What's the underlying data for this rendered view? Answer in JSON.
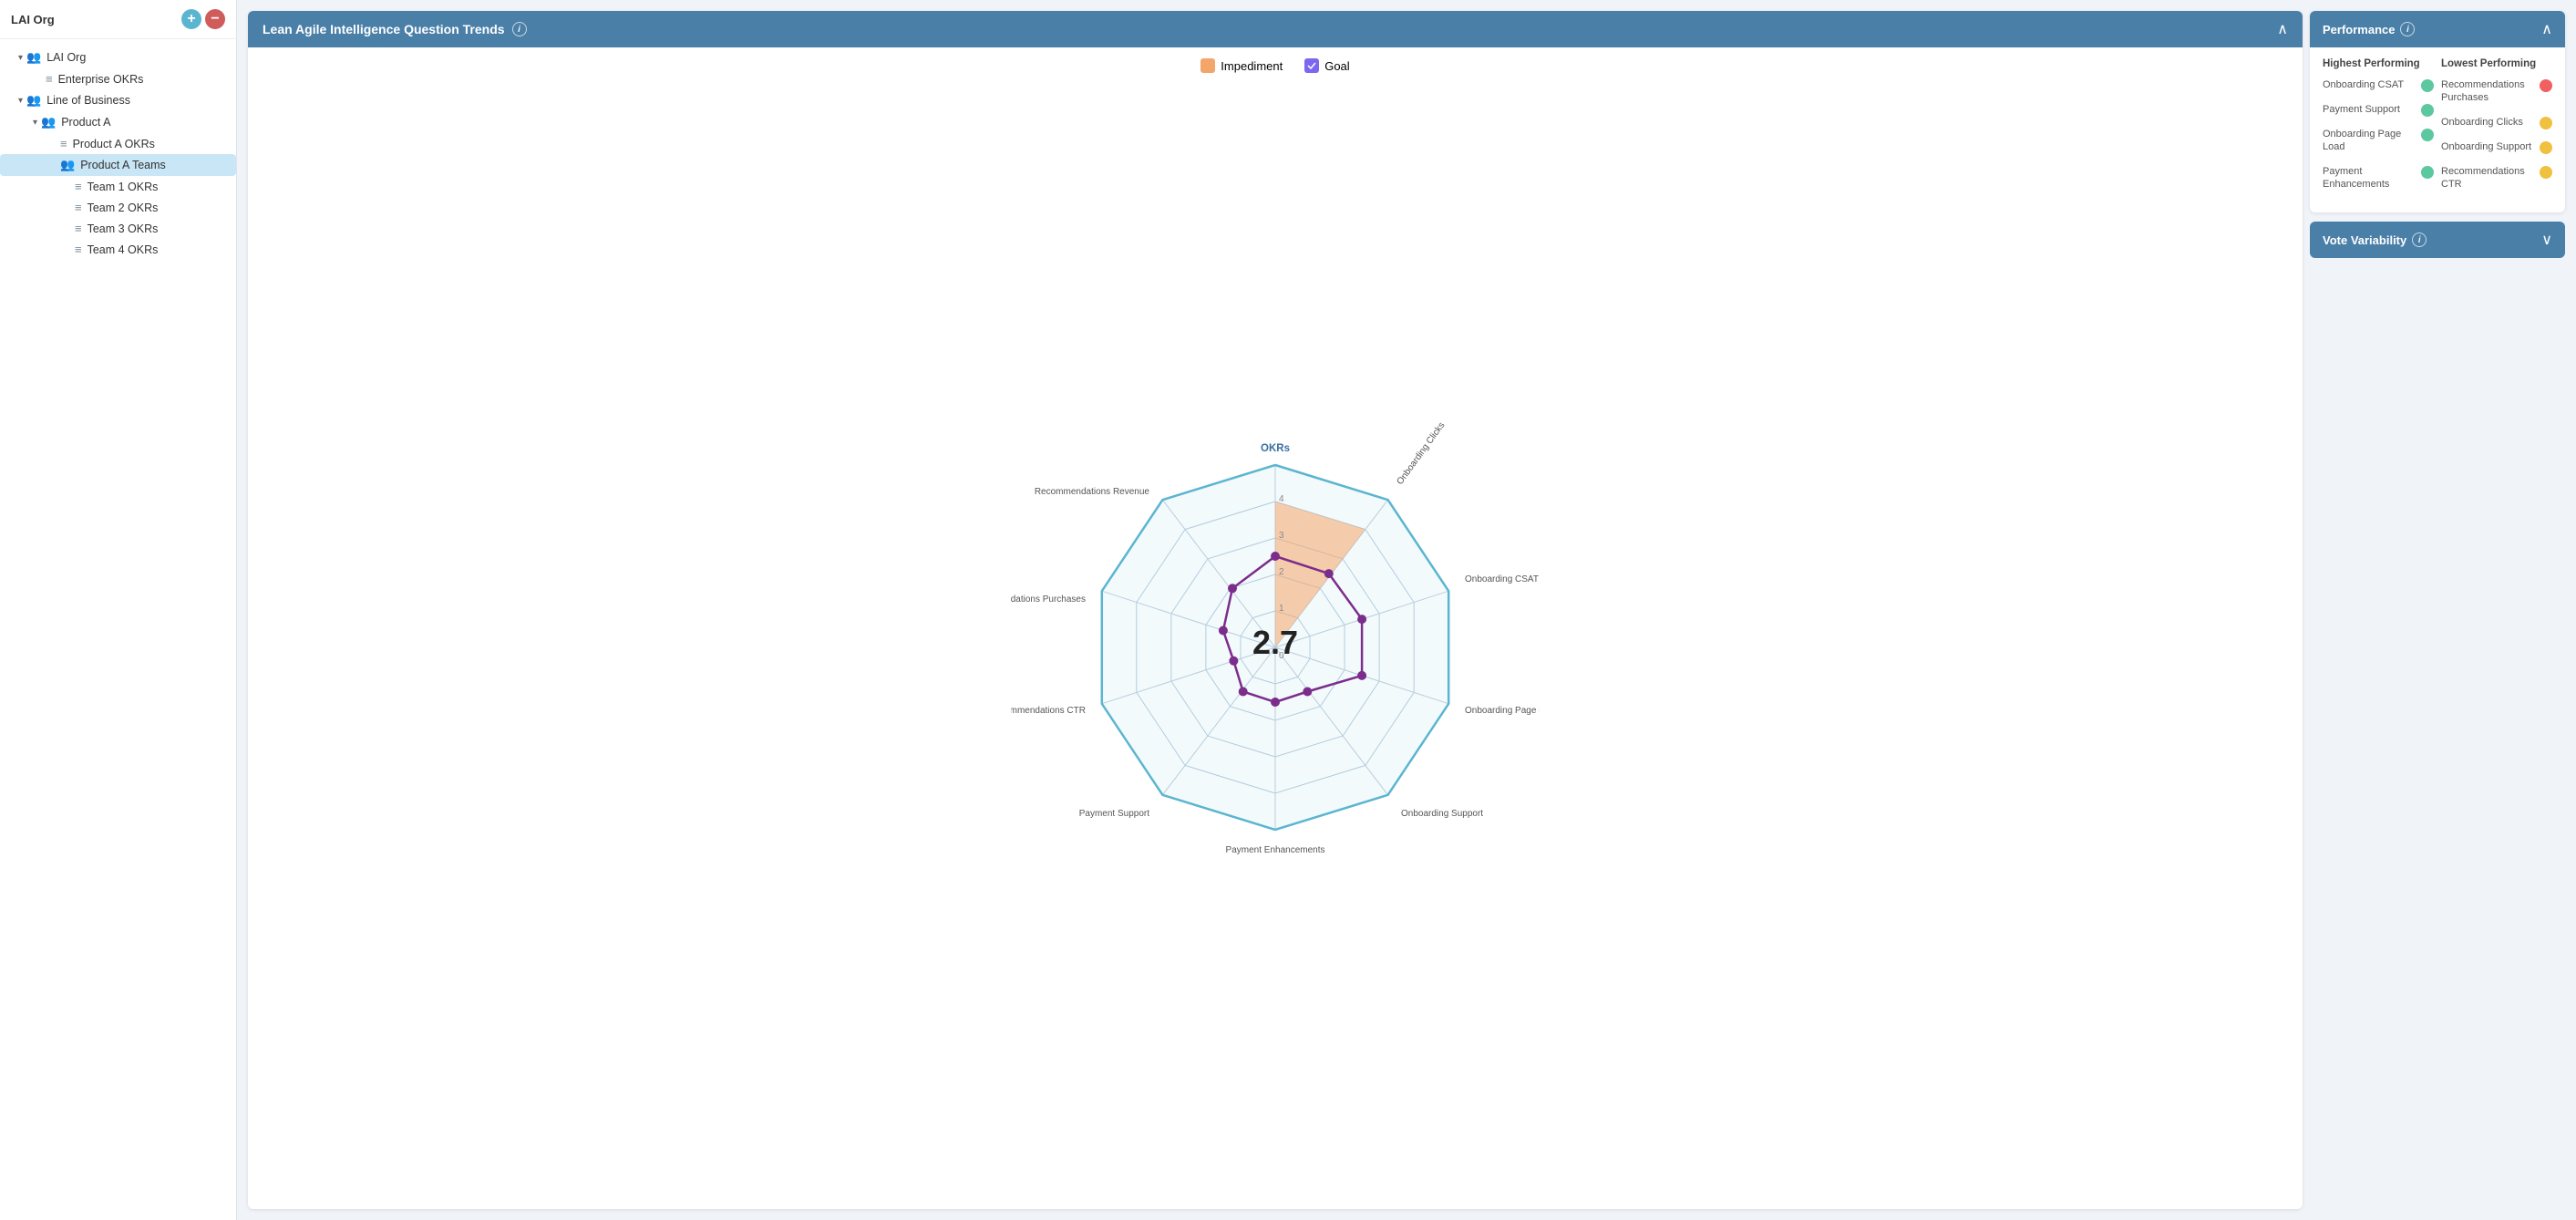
{
  "sidebar": {
    "header": {
      "title": "LAI Org",
      "add_label": "+",
      "remove_label": "−"
    },
    "tree": [
      {
        "id": "lai-org",
        "label": "LAI Org",
        "indent": 1,
        "type": "group",
        "chevron": "▾"
      },
      {
        "id": "enterprise-okrs",
        "label": "Enterprise OKRs",
        "indent": 2,
        "type": "okr"
      },
      {
        "id": "line-of-business",
        "label": "Line of Business",
        "indent": 1,
        "type": "group",
        "chevron": "▾"
      },
      {
        "id": "product-a",
        "label": "Product A",
        "indent": 2,
        "type": "group",
        "chevron": "▾"
      },
      {
        "id": "product-a-okrs",
        "label": "Product A OKRs",
        "indent": 3,
        "type": "okr"
      },
      {
        "id": "product-a-teams",
        "label": "Product A Teams",
        "indent": 3,
        "type": "group",
        "selected": true
      },
      {
        "id": "team1-okrs",
        "label": "Team 1 OKRs",
        "indent": 4,
        "type": "okr"
      },
      {
        "id": "team2-okrs",
        "label": "Team 2 OKRs",
        "indent": 4,
        "type": "okr"
      },
      {
        "id": "team3-okrs",
        "label": "Team 3 OKRs",
        "indent": 4,
        "type": "okr"
      },
      {
        "id": "team4-okrs",
        "label": "Team 4 OKRs",
        "indent": 4,
        "type": "okr"
      }
    ]
  },
  "chart_panel": {
    "title": "Lean Agile Intelligence Question Trends",
    "legend": {
      "impediment": "Impediment",
      "goal": "Goal"
    },
    "center_value": "2.7",
    "axes": [
      "OKRs",
      "Onboarding Clicks",
      "Onboarding CSAT",
      "Onboarding Page Load",
      "Onboarding Support",
      "Payment Enhancements",
      "Payment Support",
      "Recommendations CTR",
      "Recommendations Purchases",
      "Recommendations Revenue"
    ]
  },
  "performance": {
    "title": "Performance",
    "highest_title": "Highest Performing",
    "lowest_title": "Lowest Performing",
    "highest": [
      {
        "label": "Onboarding CSAT",
        "color": "green"
      },
      {
        "label": "Payment Support",
        "color": "green"
      },
      {
        "label": "Onboarding Page Load",
        "color": "green"
      },
      {
        "label": "Payment Enhancements",
        "color": "green"
      }
    ],
    "lowest": [
      {
        "label": "Recommendations Purchases",
        "color": "red"
      },
      {
        "label": "Onboarding Clicks",
        "color": "yellow"
      },
      {
        "label": "Onboarding Support",
        "color": "yellow"
      },
      {
        "label": "Recommendations CTR",
        "color": "yellow"
      }
    ]
  },
  "vote_variability": {
    "title": "Vote Variability"
  }
}
